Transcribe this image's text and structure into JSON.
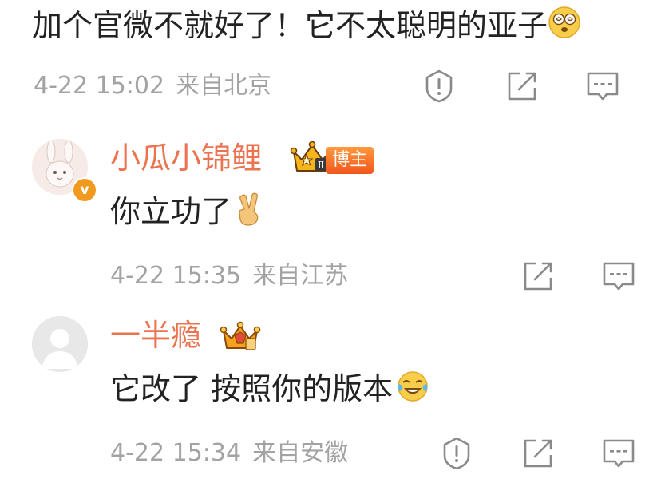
{
  "parent_comment": {
    "text": "加个官微不就好了！它不太聪明的亚子",
    "emoji": "dizzy-face-emoji",
    "date": "4-22 15:02",
    "location": "来自北京"
  },
  "replies": [
    {
      "username": "小瓜小锦鲤",
      "badge_label": "博主",
      "crown_mark": "Ⅱ",
      "verified_mark": "v",
      "text": "你立功了",
      "emoji": "victory-hand-emoji",
      "date": "4-22 15:35",
      "location": "来自江苏"
    },
    {
      "username": "一半瘾",
      "text": "它改了 按照你的版本",
      "emoji": "tears-of-joy-emoji",
      "date": "4-22 15:34",
      "location": "来自安徽"
    }
  ],
  "colors": {
    "username": "#eb7350",
    "meta": "#a3a3a3",
    "text": "#222222",
    "verified": "#f29a1f"
  }
}
